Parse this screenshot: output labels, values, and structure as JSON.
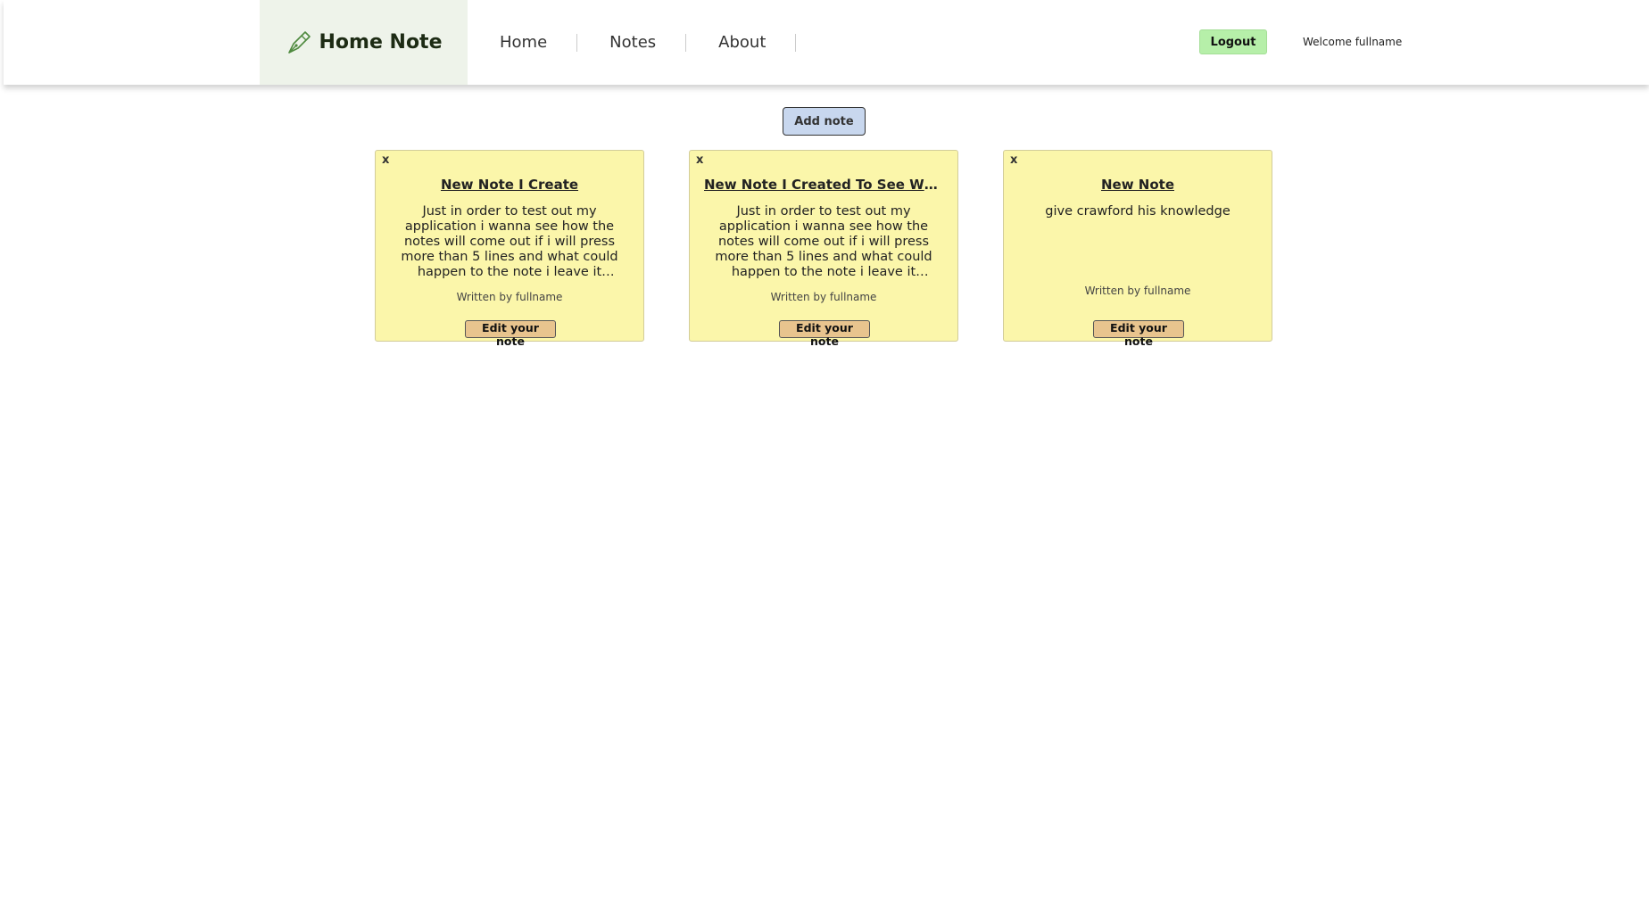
{
  "header": {
    "brand": {
      "icon": "pen-icon",
      "name": "Home Note",
      "accent": "#4f8a3f"
    },
    "nav": [
      {
        "label": "Home"
      },
      {
        "label": "Notes"
      },
      {
        "label": "About"
      }
    ],
    "logout_label": "Logout",
    "welcome_text": "Welcome fullname"
  },
  "main": {
    "add_note_label": "Add note",
    "notes": [
      {
        "close_label": "x",
        "title": "New Note I Create",
        "body": "Just in order to test out my application i wanna see how the notes will come out if i will press more than 5 lines and what could happen to the note i leave it unintended just like i do now im writing",
        "author": "Written by fullname",
        "edit_label": "Edit your note"
      },
      {
        "close_label": "x",
        "title": "New Note I Created To See What Happens",
        "body": "Just in order to test out my application i wanna see how the notes will come out if i will press more than 5 lines and what could happen to the note i leave it unintended just like i do now im writing",
        "author": "Written by fullname",
        "edit_label": "Edit your note"
      },
      {
        "close_label": "x",
        "title": "New Note",
        "body": "give crawford his knowledge",
        "author": "Written by fullname",
        "edit_label": "Edit your note"
      }
    ]
  },
  "colors": {
    "brand_bg": "#eef3ea",
    "logout_bg": "#b6efa9",
    "add_note_bg": "#c8d7ee",
    "note_bg": "#fbf6aa",
    "edit_button_bg": "#e8c48e"
  }
}
